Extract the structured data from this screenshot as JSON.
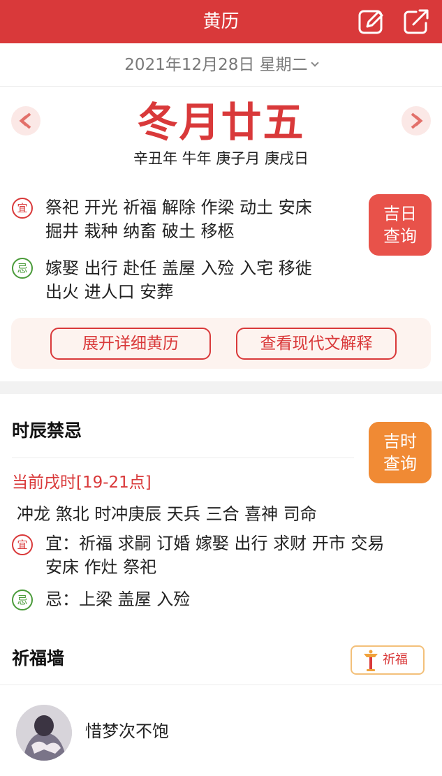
{
  "header": {
    "title": "黄历"
  },
  "date_selector": {
    "text": "2021年12月28日 星期二"
  },
  "lunar": {
    "date": "冬月廿五",
    "ganzhi": "辛丑年 牛年 庚子月 庚戌日"
  },
  "day": {
    "yi_mark": "宜",
    "yi_lines": [
      "祭祀 开光 祈福 解除 作梁 动土 安床",
      "掘井 栽种 纳畜 破土 移柩"
    ],
    "ji_mark": "忌",
    "ji_lines": [
      "嫁娶 出行 赴任 盖屋 入殓 入宅 移徙",
      "出火 进人口 安葬"
    ],
    "lucky_day_button": [
      "吉日",
      "查询"
    ],
    "expand_button": "展开详细黄历",
    "modern_button": "查看现代文解释"
  },
  "hour_taboo": {
    "title": "时辰禁忌",
    "lucky_hour_button": [
      "吉时",
      "查询"
    ],
    "current": "当前戌时[19-21点]",
    "shensha": "冲龙 煞北 时冲庚辰 天兵 三合 喜神 司命",
    "yi_mark": "宜",
    "yi_lines": [
      "宜：祈福 求嗣 订婚 嫁娶 出行 求财 开市 交易",
      "安床 作灶 祭祀"
    ],
    "ji_mark": "忌",
    "ji_line": "忌：上梁 盖屋 入殓"
  },
  "blessing_wall": {
    "title": "祈福墙",
    "button_label": "祈福",
    "user_name": "惜梦次不饱"
  },
  "colors": {
    "brand_red": "#d9393a",
    "orange": "#f08a34",
    "green": "#4a9b3a"
  }
}
